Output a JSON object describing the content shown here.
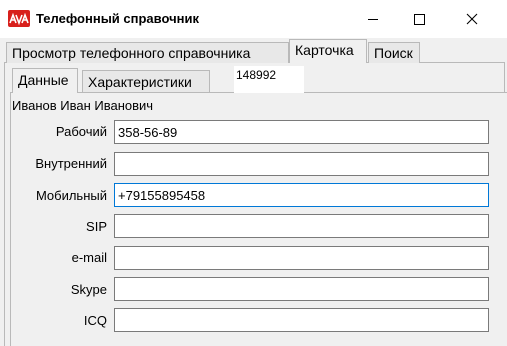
{
  "window": {
    "title": "Телефонный справочник"
  },
  "tabs": {
    "outer": [
      "Просмотр телефонного справочника",
      "Карточка",
      "Поиск"
    ],
    "inner": [
      "Данные",
      "Характеристики"
    ]
  },
  "card": {
    "id": "148992",
    "person_name": "Иванов Иван Иванович"
  },
  "fields": {
    "work": {
      "label": "Рабочий",
      "value": "358-56-89"
    },
    "internal": {
      "label": "Внутренний",
      "value": ""
    },
    "mobile": {
      "label": "Мобильный",
      "value": "+79155895458"
    },
    "sip": {
      "label": "SIP",
      "value": ""
    },
    "email": {
      "label": "e-mail",
      "value": ""
    },
    "skype": {
      "label": "Skype",
      "value": ""
    },
    "icq": {
      "label": "ICQ",
      "value": ""
    }
  },
  "colors": {
    "logo": "#d8201c",
    "focus_border": "#0078d7"
  },
  "icons": {
    "logo": "app-logo-icon",
    "minimize": "minimize-icon",
    "maximize": "maximize-icon",
    "close": "close-icon"
  }
}
